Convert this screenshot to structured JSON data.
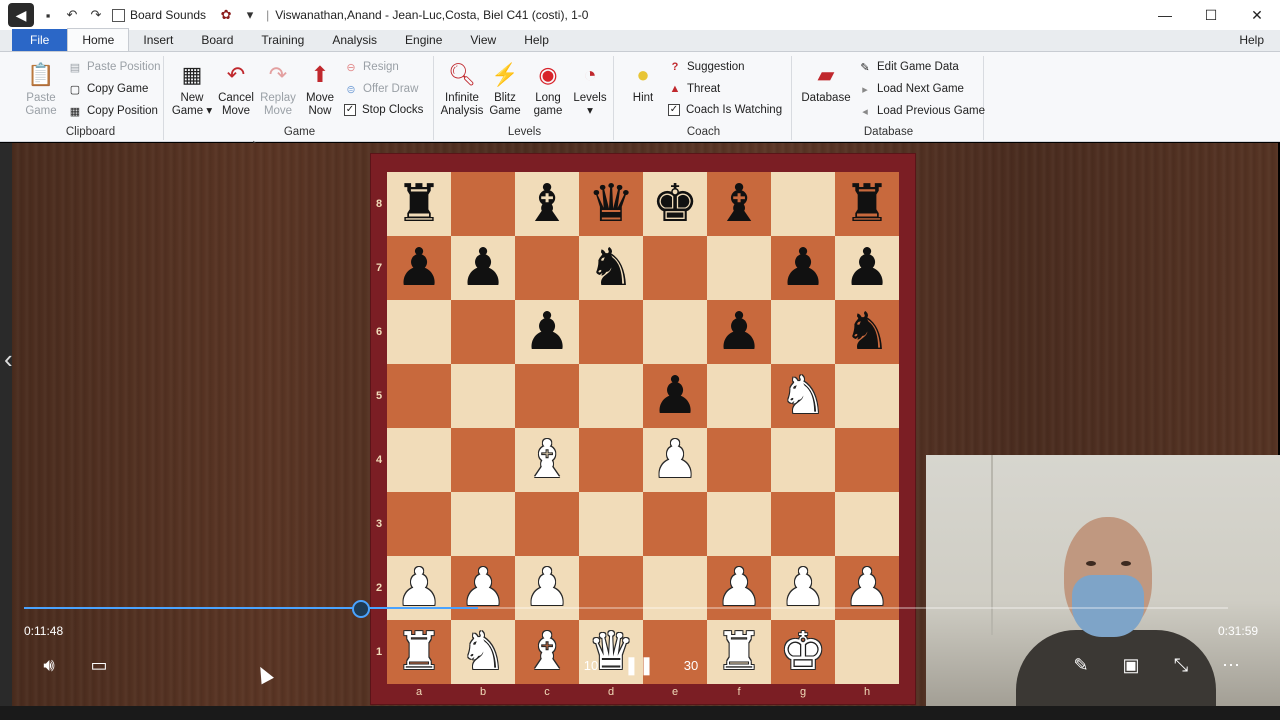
{
  "titlebar": {
    "board_sounds": "Board Sounds",
    "title": "Viswanathan,Anand - Jean-Luc,Costa, Biel  C41  (costi), 1-0"
  },
  "tabs": [
    "File",
    "Home",
    "Insert",
    "Board",
    "Training",
    "Analysis",
    "Engine",
    "View",
    "Help"
  ],
  "help_right": "Help",
  "ribbon": {
    "clipboard": {
      "paste_game": [
        "Paste",
        "Game"
      ],
      "paste_position": "Paste Position",
      "copy_game": "Copy Game",
      "copy_position": "Copy Position",
      "label": "Clipboard"
    },
    "game": {
      "new_game": [
        "New",
        "Game ▾"
      ],
      "cancel_move": [
        "Cancel",
        "Move"
      ],
      "replay_move": [
        "Replay",
        "Move"
      ],
      "move_now": [
        "Move",
        "Now"
      ],
      "resign": "Resign",
      "offer_draw": "Offer Draw",
      "stop_clocks": "Stop Clocks",
      "label": "Game"
    },
    "levels": {
      "infinite": [
        "Infinite",
        "Analysis"
      ],
      "blitz": [
        "Blitz",
        "Game"
      ],
      "long": [
        "Long",
        "game"
      ],
      "levels": [
        "Levels",
        "▾"
      ],
      "label": "Levels"
    },
    "coach": {
      "hint": "Hint",
      "suggestion": "Suggestion",
      "threat": "Threat",
      "coach_watching": "Coach Is Watching",
      "label": "Coach"
    },
    "database": {
      "database": "Database",
      "edit_game_data": "Edit Game Data",
      "load_next": "Load Next Game",
      "load_previous": "Load Previous Game",
      "label": "Database"
    }
  },
  "board": {
    "ranks": [
      "8",
      "7",
      "6",
      "5",
      "4",
      "3",
      "2",
      "1"
    ],
    "files": [
      "a",
      "b",
      "c",
      "d",
      "e",
      "f",
      "g",
      "h"
    ],
    "position": [
      [
        "bR",
        "",
        "bB",
        "bQ",
        "bK",
        "bB",
        "",
        "bR"
      ],
      [
        "bP",
        "bP",
        "",
        "bN",
        "",
        "",
        "bP",
        "bP"
      ],
      [
        "",
        "",
        "bP",
        "",
        "",
        "bP",
        "",
        "bN"
      ],
      [
        "",
        "",
        "",
        "",
        "bP",
        "",
        "wN",
        ""
      ],
      [
        "",
        "",
        "wB",
        "",
        "wP",
        "",
        "",
        ""
      ],
      [
        "",
        "",
        "",
        "",
        "",
        "",
        "",
        ""
      ],
      [
        "wP",
        "wP",
        "wP",
        "",
        "",
        "wP",
        "wP",
        "wP"
      ],
      [
        "wR",
        "wN",
        "wB",
        "wQ",
        "",
        "wR",
        "wK",
        ""
      ]
    ]
  },
  "player": {
    "current_time": "0:11:48",
    "total_time": "0:31:59",
    "progress_fraction": 0.3768,
    "skip_back": "10",
    "skip_forward": "30"
  }
}
